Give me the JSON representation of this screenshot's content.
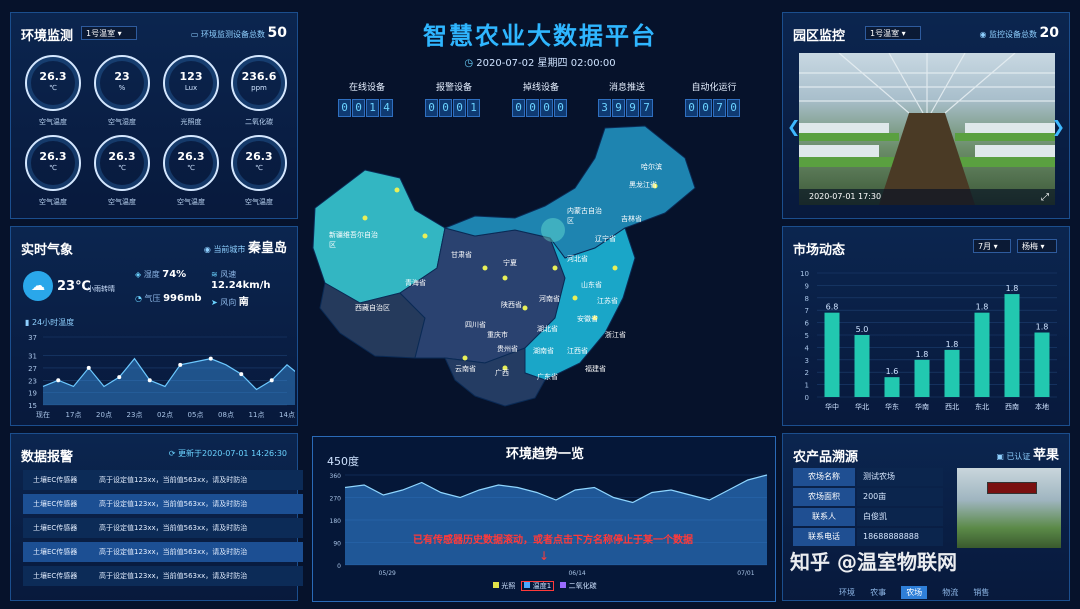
{
  "title": "智慧农业大数据平台",
  "datetime": "2020-07-02 星期四 02:00:00",
  "stats": [
    {
      "label": "在线设备",
      "digits": [
        "0",
        "0",
        "1",
        "4"
      ]
    },
    {
      "label": "报警设备",
      "digits": [
        "0",
        "0",
        "0",
        "1"
      ]
    },
    {
      "label": "掉线设备",
      "digits": [
        "0",
        "0",
        "0",
        "0"
      ]
    },
    {
      "label": "消息推送",
      "digits": [
        "3",
        "9",
        "9",
        "7"
      ]
    },
    {
      "label": "自动化运行",
      "digits": [
        "0",
        "0",
        "7",
        "0"
      ]
    }
  ],
  "env": {
    "title": "环境监测",
    "select": "1号温室",
    "total_label": "环境监测设备总数",
    "total": "50",
    "gauges": [
      {
        "value": "26.3",
        "unit": "℃",
        "label": "空气温度"
      },
      {
        "value": "23",
        "unit": "%",
        "label": "空气湿度"
      },
      {
        "value": "123",
        "unit": "Lux",
        "label": "光照度"
      },
      {
        "value": "236.6",
        "unit": "ppm",
        "label": "二氧化碳"
      },
      {
        "value": "26.3",
        "unit": "℃",
        "label": "空气温度"
      },
      {
        "value": "26.3",
        "unit": "℃",
        "label": "空气温度"
      },
      {
        "value": "26.3",
        "unit": "℃",
        "label": "空气温度"
      },
      {
        "value": "26.3",
        "unit": "℃",
        "label": "空气温度"
      }
    ]
  },
  "weather": {
    "title": "实时气象",
    "city_label": "当前城市",
    "city": "秦皇岛",
    "temp": "23℃",
    "condition": "小雨转晴",
    "humidity_label": "湿度",
    "humidity": "74%",
    "wind_speed_label": "风速",
    "wind_speed": "12.24km/h",
    "pressure_label": "气压",
    "pressure": "996mb",
    "wind_dir_label": "风向",
    "wind_dir": "南",
    "hourly_label": "24小时温度"
  },
  "alarm": {
    "title": "数据报警",
    "updated": "更新于2020-07-01 14:26:30",
    "rows": [
      {
        "device": "土壤EC传感器",
        "msg": "高于设定值123xx，当前值563xx，请及时防治"
      },
      {
        "device": "土壤EC传感器",
        "msg": "高于设定值123xx，当前值563xx，请及时防治"
      },
      {
        "device": "土壤EC传感器",
        "msg": "高于设定值123xx，当前值563xx，请及时防治"
      },
      {
        "device": "土壤EC传感器",
        "msg": "高于设定值123xx，当前值563xx，请及时防治"
      },
      {
        "device": "土壤EC传感器",
        "msg": "高于设定值123xx，当前值563xx，请及时防治"
      }
    ]
  },
  "monitor": {
    "title": "园区监控",
    "select": "1号温室",
    "total_label": "监控设备总数",
    "total": "20",
    "timestamp": "2020-07-01 17:30"
  },
  "market": {
    "title": "市场动态",
    "month": "7月",
    "product": "杨梅"
  },
  "trace": {
    "title": "农产品溯源",
    "cert": "已认证",
    "product": "苹果",
    "rows": [
      {
        "k": "农场名称",
        "v": "测试农场"
      },
      {
        "k": "农场面积",
        "v": "200亩"
      },
      {
        "k": "联系人",
        "v": "白俊凯"
      },
      {
        "k": "联系电话",
        "v": "18688888888"
      }
    ],
    "tabs": [
      "环境",
      "农事",
      "农场",
      "物流",
      "销售"
    ],
    "active_tab": "农场"
  },
  "trend": {
    "title": "环境趋势一览",
    "unit_label": "450度",
    "notice": "已有传感器历史数据滚动，或者点击下方名称停止于某一个数据",
    "legend": [
      "光照",
      "温度1",
      "二氧化碳"
    ]
  },
  "map_labels": [
    "新疆维吾尔自治区",
    "西藏自治区",
    "青海省",
    "甘肃省",
    "内蒙古自治区",
    "黑龙江省",
    "吉林省",
    "辽宁省",
    "河北省",
    "山东省",
    "河南省",
    "陕西省",
    "四川省",
    "湖北省",
    "安徽省",
    "江苏省",
    "浙江省",
    "湖南省",
    "江西省",
    "福建省",
    "贵州省",
    "云南省",
    "广西",
    "广东省",
    "宁夏",
    "重庆市",
    "哈尔滨"
  ],
  "watermark": "知乎 @温室物联网",
  "chart_data": [
    {
      "type": "area",
      "title": "24小时温度",
      "categories": [
        "现在",
        "17点",
        "20点",
        "23点",
        "02点",
        "05点",
        "08点",
        "11点",
        "14点"
      ],
      "x_index": [
        0,
        0.5,
        1,
        1.5,
        2,
        2.5,
        3,
        3.5,
        4,
        4.5,
        5,
        5.5,
        6,
        6.5,
        7,
        7.5,
        8,
        8.5
      ],
      "values": [
        21,
        23,
        21,
        27,
        21,
        24,
        30,
        23,
        21,
        28,
        29,
        30,
        28,
        25,
        20,
        23,
        28,
        24
      ],
      "yticks": [
        15,
        19,
        23,
        27,
        31,
        37
      ],
      "ylim": [
        15,
        37
      ],
      "grid": true
    },
    {
      "type": "bar",
      "title": "市场动态",
      "categories": [
        "华中",
        "华北",
        "华东",
        "华南",
        "西北",
        "东北",
        "西南",
        "本地"
      ],
      "values": [
        6.8,
        5.0,
        1.6,
        3.0,
        3.8,
        6.8,
        8.3,
        5.2
      ],
      "labels": [
        "6.8",
        "5.0",
        "1.6",
        "1.8",
        "1.8",
        "1.8",
        "1.8",
        "1.8"
      ],
      "yticks": [
        0,
        1,
        2,
        3,
        4,
        5,
        6,
        7,
        8,
        9,
        10
      ],
      "ylim": [
        0,
        10
      ],
      "grid": true
    },
    {
      "type": "area",
      "title": "环境趋势一览",
      "categories": [
        "05/29",
        "06/14",
        "07/01"
      ],
      "yticks": [
        0,
        90,
        180,
        270,
        360
      ],
      "ylim": [
        0,
        360
      ],
      "values": [
        310,
        320,
        280,
        300,
        330,
        290,
        270,
        300,
        320,
        310,
        290,
        260,
        300,
        310,
        270,
        250,
        290,
        300,
        280,
        260,
        300,
        340,
        360
      ],
      "legend": [
        "光照",
        "温度1",
        "二氧化碳"
      ]
    }
  ]
}
